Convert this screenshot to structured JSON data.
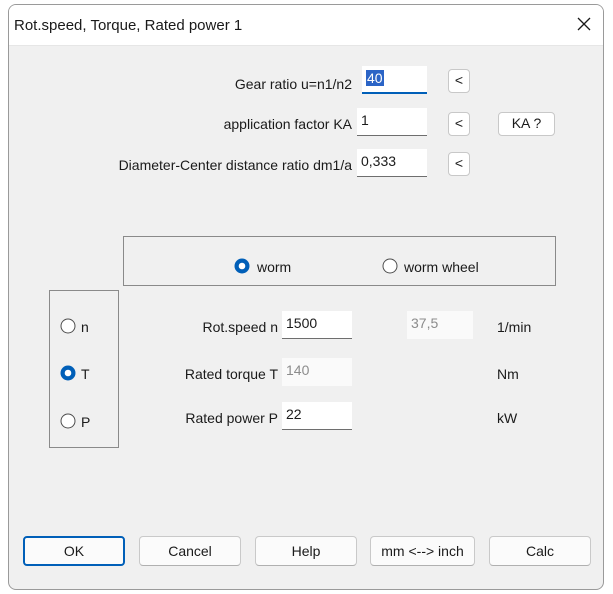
{
  "window": {
    "title": "Rot.speed, Torque, Rated power  1"
  },
  "top": {
    "gear_ratio_label": "Gear ratio u=n1/n2",
    "gear_ratio_value": "40",
    "app_factor_label": "application factor KA",
    "app_factor_value": "1",
    "diameter_label": "Diameter-Center distance ratio dm1/a",
    "diameter_value": "0,333",
    "arrow_button_label": "<",
    "ka_button_label": "KA ?"
  },
  "selector": {
    "worm_label": "worm",
    "worm_wheel_label": "worm wheel",
    "selected": "worm"
  },
  "mode": {
    "n_label": "n",
    "t_label": "T",
    "p_label": "P",
    "selected": "T"
  },
  "values": {
    "speed_label": "Rot.speed n",
    "speed_value": "1500",
    "speed_computed": "37,5",
    "speed_unit": "1/min",
    "torque_label": "Rated torque T",
    "torque_value": "140",
    "torque_unit": "Nm",
    "power_label": "Rated power P",
    "power_value": "22",
    "power_unit": "kW"
  },
  "buttons": {
    "ok": "OK",
    "cancel": "Cancel",
    "help": "Help",
    "units": "mm <--> inch",
    "calc": "Calc"
  },
  "colors": {
    "accent": "#005fb8",
    "selection": "#2b64c6"
  }
}
